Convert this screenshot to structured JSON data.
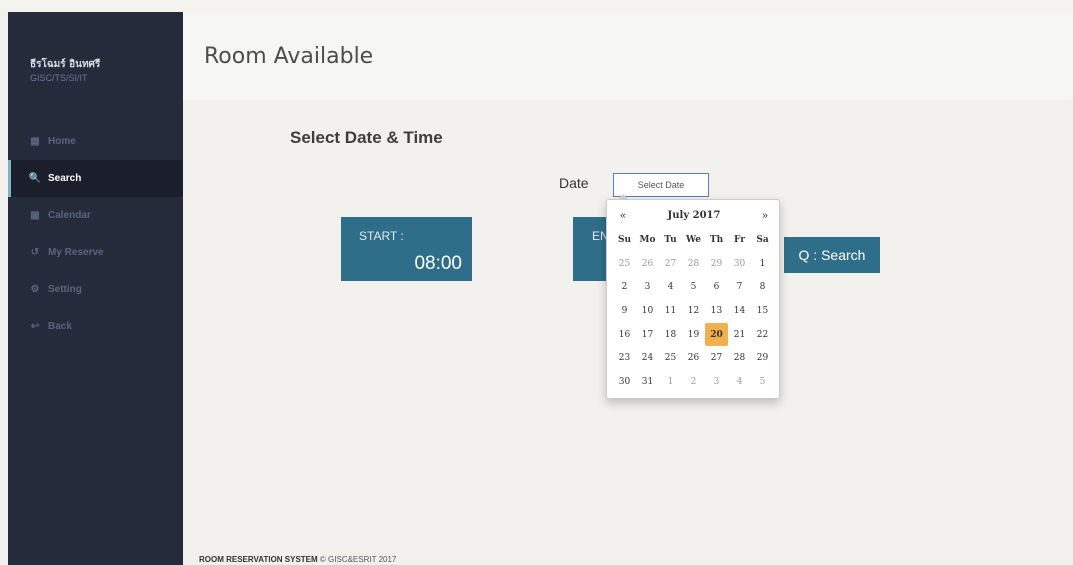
{
  "user": {
    "name": "ธีรโฉมร์ อินทศรี",
    "dept": "GISC/TS/SI/IT"
  },
  "sidebar": {
    "items": [
      {
        "label": "Home",
        "icon": "grid-icon",
        "glyph": "▦"
      },
      {
        "label": "Search",
        "icon": "search-icon",
        "glyph": "🔍"
      },
      {
        "label": "Calendar",
        "icon": "calendar-icon",
        "glyph": "▦"
      },
      {
        "label": "My Reserve",
        "icon": "history-icon",
        "glyph": "↺"
      },
      {
        "label": "Setting",
        "icon": "gear-icon",
        "glyph": "⚙"
      },
      {
        "label": "Back",
        "icon": "back-icon",
        "glyph": "↩"
      }
    ],
    "active_index": 1
  },
  "header": {
    "title": "Room Available"
  },
  "main": {
    "section_title": "Select Date & Time",
    "date_label": "Date",
    "date_placeholder": "Select Date",
    "start": {
      "label": "START :",
      "value": "08:00"
    },
    "end": {
      "label": "EN"
    },
    "search_button": "Q : Search"
  },
  "datepicker": {
    "month_label": "July 2017",
    "prev": "«",
    "next": "»",
    "weekdays": [
      "Su",
      "Mo",
      "Tu",
      "We",
      "Th",
      "Fr",
      "Sa"
    ],
    "weeks": [
      [
        "25",
        "26",
        "27",
        "28",
        "29",
        "30",
        "1"
      ],
      [
        "2",
        "3",
        "4",
        "5",
        "6",
        "7",
        "8"
      ],
      [
        "9",
        "10",
        "11",
        "12",
        "13",
        "14",
        "15"
      ],
      [
        "16",
        "17",
        "18",
        "19",
        "20",
        "21",
        "22"
      ],
      [
        "23",
        "24",
        "25",
        "26",
        "27",
        "28",
        "29"
      ],
      [
        "30",
        "31",
        "1",
        "2",
        "3",
        "4",
        "5"
      ]
    ],
    "selected_day": "20",
    "selected_color": "#f1b04d"
  },
  "footer": {
    "brand": "ROOM RESERVATION SYSTEM",
    "copyright": "© GISC&ESRIT 2017"
  },
  "colors": {
    "sidebar_bg": "#262b3b",
    "accent": "#2f6e89",
    "input_border": "#5a7fb4"
  }
}
